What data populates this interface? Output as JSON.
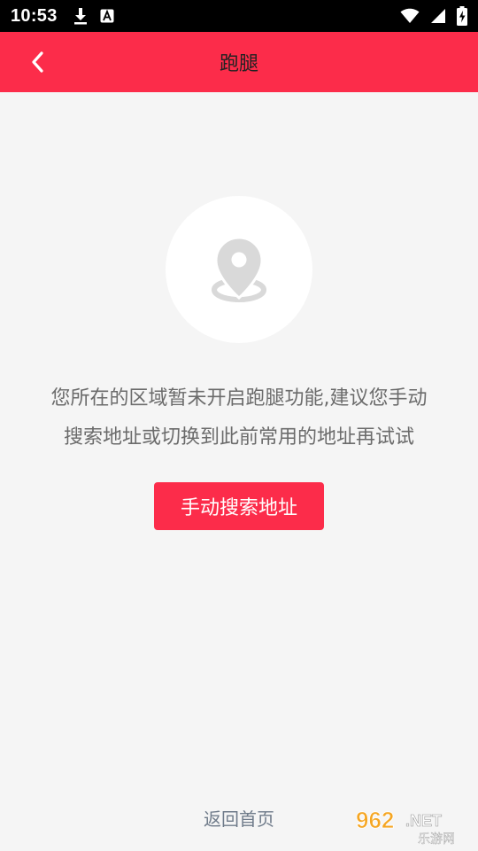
{
  "status_bar": {
    "time": "10:53",
    "icons": [
      "download-icon",
      "a-notification-icon",
      "wifi-icon",
      "signal-icon",
      "battery-charging-icon"
    ]
  },
  "header": {
    "title": "跑腿",
    "back_icon": "chevron-left-icon",
    "background_color": "#fc2c4a"
  },
  "empty_state": {
    "icon": "location-pin-icon",
    "message_line1": "您所在的区域暂未开启跑腿功能,建议您手动",
    "message_line2": "搜索地址或切换到此前常用的地址再试试"
  },
  "search_button": {
    "label": "手动搜索地址"
  },
  "footer": {
    "home_link_label": "返回首页"
  },
  "watermark": {
    "text_top": "962.NET",
    "text_bottom": "乐游网"
  }
}
